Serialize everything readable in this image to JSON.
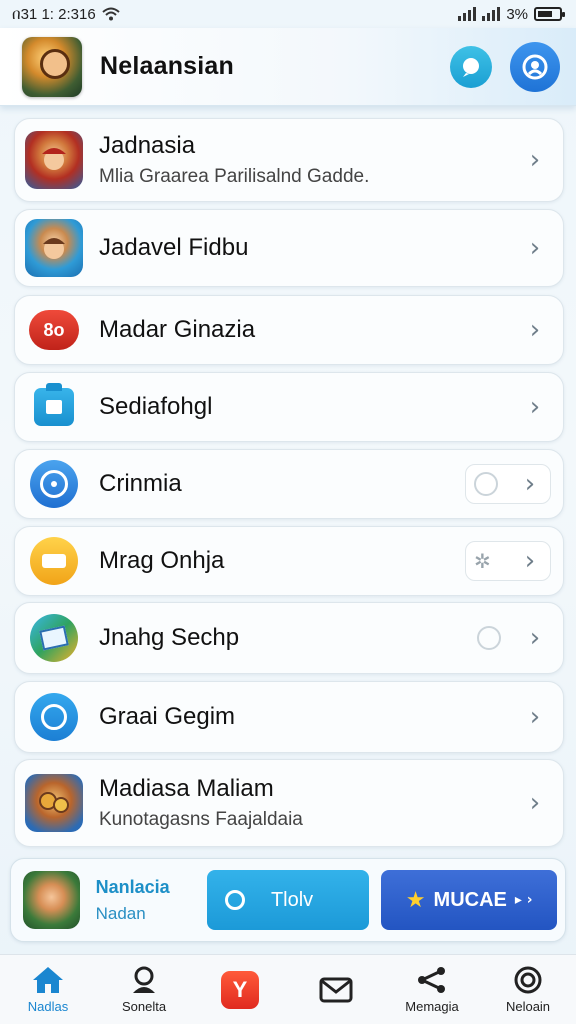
{
  "status_bar": {
    "time": "በ31 1: 2:316",
    "battery": "3%"
  },
  "header": {
    "title": "Nelaansian"
  },
  "items": [
    {
      "title": "Jadnasia",
      "subtitle": "Mlia Graarea Parilisalnd Gadde."
    },
    {
      "title": "Jadavel Fidbu",
      "subtitle": ""
    },
    {
      "title": "Madar Ginazia",
      "subtitle": "",
      "badge": "8o"
    },
    {
      "title": "Sediafohgl",
      "subtitle": ""
    },
    {
      "title": "Crinmia",
      "subtitle": ""
    },
    {
      "title": "Mrag Onhja",
      "subtitle": ""
    },
    {
      "title": "Jnahg Sechp",
      "subtitle": ""
    },
    {
      "title": "Graai Gegim",
      "subtitle": ""
    },
    {
      "title": "Madiasa Maliam",
      "subtitle": "Kunotagasns Faajaldaia"
    }
  ],
  "promo": {
    "title": "Nanlacia",
    "subtitle": "Nadan",
    "button1": "Tlolv",
    "button2": "MUCAE",
    "colors": {
      "button1": "#1c9ad8",
      "button2": "#2355c2"
    }
  },
  "bottom_nav": [
    {
      "label": "Nadlas",
      "icon": "home-icon",
      "active": true
    },
    {
      "label": "Sonelta",
      "icon": "person-icon",
      "active": false
    },
    {
      "label": "",
      "icon": "app-logo-icon",
      "active": false
    },
    {
      "label": "",
      "icon": "mail-icon",
      "active": false
    },
    {
      "label": "Memagia",
      "icon": "share-icon",
      "active": false
    },
    {
      "label": "Neloain",
      "icon": "target-icon",
      "active": false
    }
  ]
}
